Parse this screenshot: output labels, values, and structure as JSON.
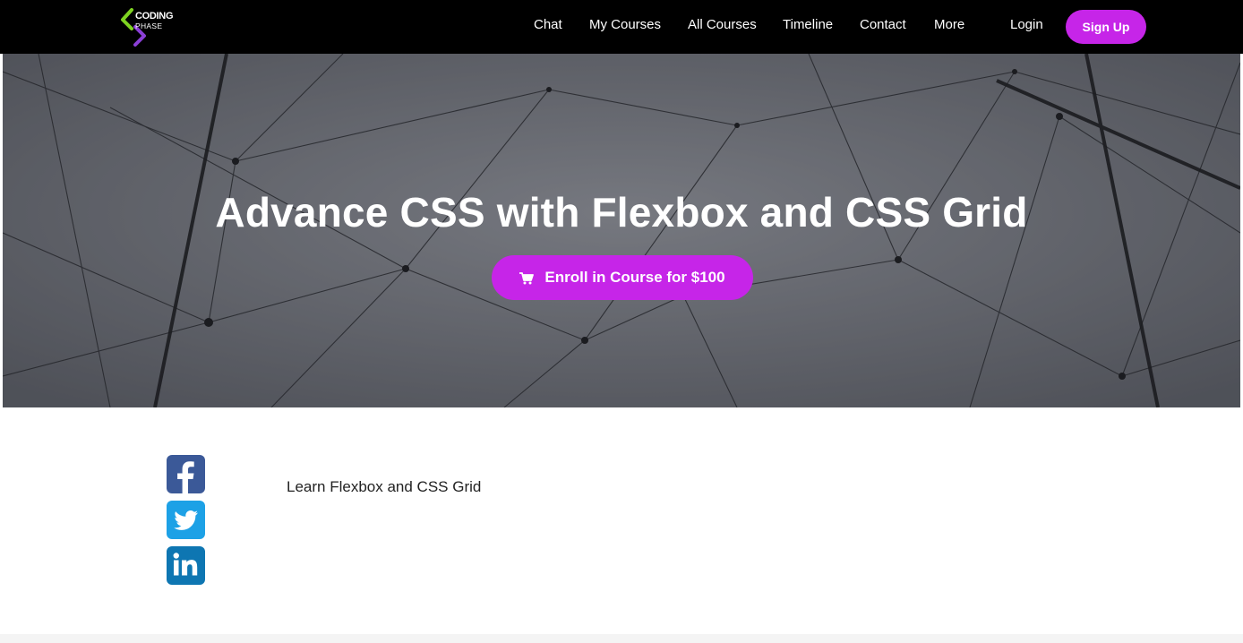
{
  "brand": {
    "logo_line1": "CODING",
    "logo_line2": "PHASE"
  },
  "nav": {
    "items": [
      "Chat",
      "My Courses",
      "All Courses",
      "Timeline",
      "Contact",
      "More"
    ],
    "login": "Login",
    "signup": "Sign Up"
  },
  "hero": {
    "title": "Advance CSS with Flexbox and CSS Grid",
    "enroll_label": "Enroll in Course for $100",
    "enroll_icon": "shopping-cart-icon"
  },
  "content": {
    "description": "Learn Flexbox and CSS Grid",
    "social": [
      "facebook-icon",
      "twitter-icon",
      "linkedin-icon"
    ]
  },
  "colors": {
    "accent": "#c625e8",
    "navbar": "#000000",
    "facebook": "#3b5998",
    "twitter": "#1da1e6",
    "linkedin": "#0e76b2"
  }
}
